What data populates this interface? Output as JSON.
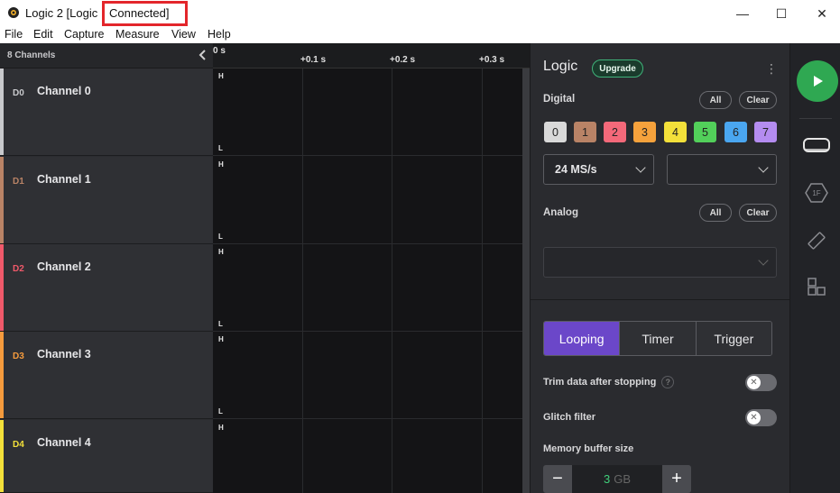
{
  "window": {
    "title": "Logic 2 [Logic",
    "title_suffix": "Connected]",
    "minimize": "—",
    "maximize": "☐",
    "close": "✕"
  },
  "menu": [
    "File",
    "Edit",
    "Capture",
    "Measure",
    "View",
    "Help"
  ],
  "channels_panel": {
    "count_label": "8 Channels",
    "channels": [
      {
        "id": "D0",
        "name": "Channel 0",
        "color": "#c8c9cc"
      },
      {
        "id": "D1",
        "name": "Channel 1",
        "color": "#b98366"
      },
      {
        "id": "D2",
        "name": "Channel 2",
        "color": "#f0596a"
      },
      {
        "id": "D3",
        "name": "Channel 3",
        "color": "#f59b3d"
      },
      {
        "id": "D4",
        "name": "Channel 4",
        "color": "#f3e03a"
      }
    ]
  },
  "timeline": {
    "ticks": [
      "0 s",
      "+0.1 s",
      "+0.2 s",
      "+0.3 s"
    ],
    "high_label": "H",
    "low_label": "L"
  },
  "settings": {
    "title": "Logic",
    "upgrade": "Upgrade",
    "digital_label": "Digital",
    "all_label": "All",
    "clear_label": "Clear",
    "digital_chips": [
      {
        "label": "0",
        "color": "#d9d9d9"
      },
      {
        "label": "1",
        "color": "#b98366"
      },
      {
        "label": "2",
        "color": "#f4697a"
      },
      {
        "label": "3",
        "color": "#f6a23c"
      },
      {
        "label": "4",
        "color": "#f3e03a"
      },
      {
        "label": "5",
        "color": "#52cf5a"
      },
      {
        "label": "6",
        "color": "#4aa6f0"
      },
      {
        "label": "7",
        "color": "#b48cf0"
      }
    ],
    "digital_rate": "24 MS/s",
    "digital_rate2": "",
    "analog_label": "Analog",
    "analog_rate": "",
    "modes": [
      "Looping",
      "Timer",
      "Trigger"
    ],
    "active_mode": "Looping",
    "trim_label": "Trim data after stopping",
    "help": "?",
    "glitch_label": "Glitch filter",
    "toggle_off": "✕",
    "memory_label": "Memory buffer size",
    "memory_value": "3",
    "memory_unit": "GB",
    "minus": "−",
    "plus": "+"
  },
  "colors": {
    "accent_purple": "#6b47c9",
    "play_green": "#2fa852",
    "highlight_red": "#e3262b"
  }
}
